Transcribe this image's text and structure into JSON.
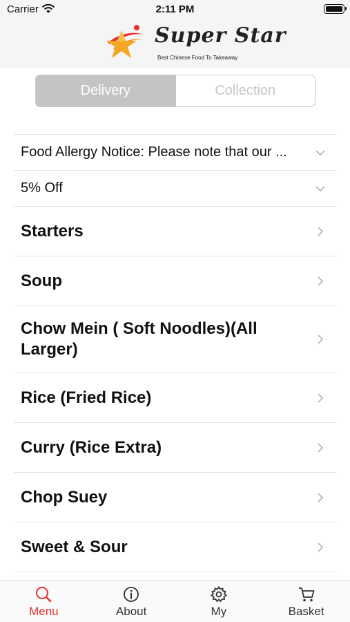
{
  "status_bar": {
    "carrier": "Carrier",
    "time": "2:11 PM"
  },
  "header": {
    "brand_name": "Super Star",
    "tagline": "Best Chinese Food To Takeaway",
    "colors": {
      "star": "#f5a623",
      "swoosh": "#e5322d"
    }
  },
  "order_mode": {
    "options": [
      "Delivery",
      "Collection"
    ],
    "selected": "Delivery"
  },
  "notices": [
    {
      "label": "Food Allergy Notice: Please note that our ..."
    },
    {
      "label": "5% Off"
    }
  ],
  "categories": [
    {
      "label": "Starters"
    },
    {
      "label": "Soup"
    },
    {
      "label": "Chow Mein ( Soft Noodles)(All Larger)"
    },
    {
      "label": "Rice (Fried Rice)"
    },
    {
      "label": "Curry (Rice Extra)"
    },
    {
      "label": "Chop Suey"
    },
    {
      "label": "Sweet & Sour"
    }
  ],
  "tabbar": {
    "active": "Menu",
    "accent_color": "#e5322d",
    "tabs": [
      {
        "label": "Menu",
        "icon": "search-icon"
      },
      {
        "label": "About",
        "icon": "info-icon"
      },
      {
        "label": "My",
        "icon": "gear-icon"
      },
      {
        "label": "Basket",
        "icon": "cart-icon"
      }
    ]
  }
}
